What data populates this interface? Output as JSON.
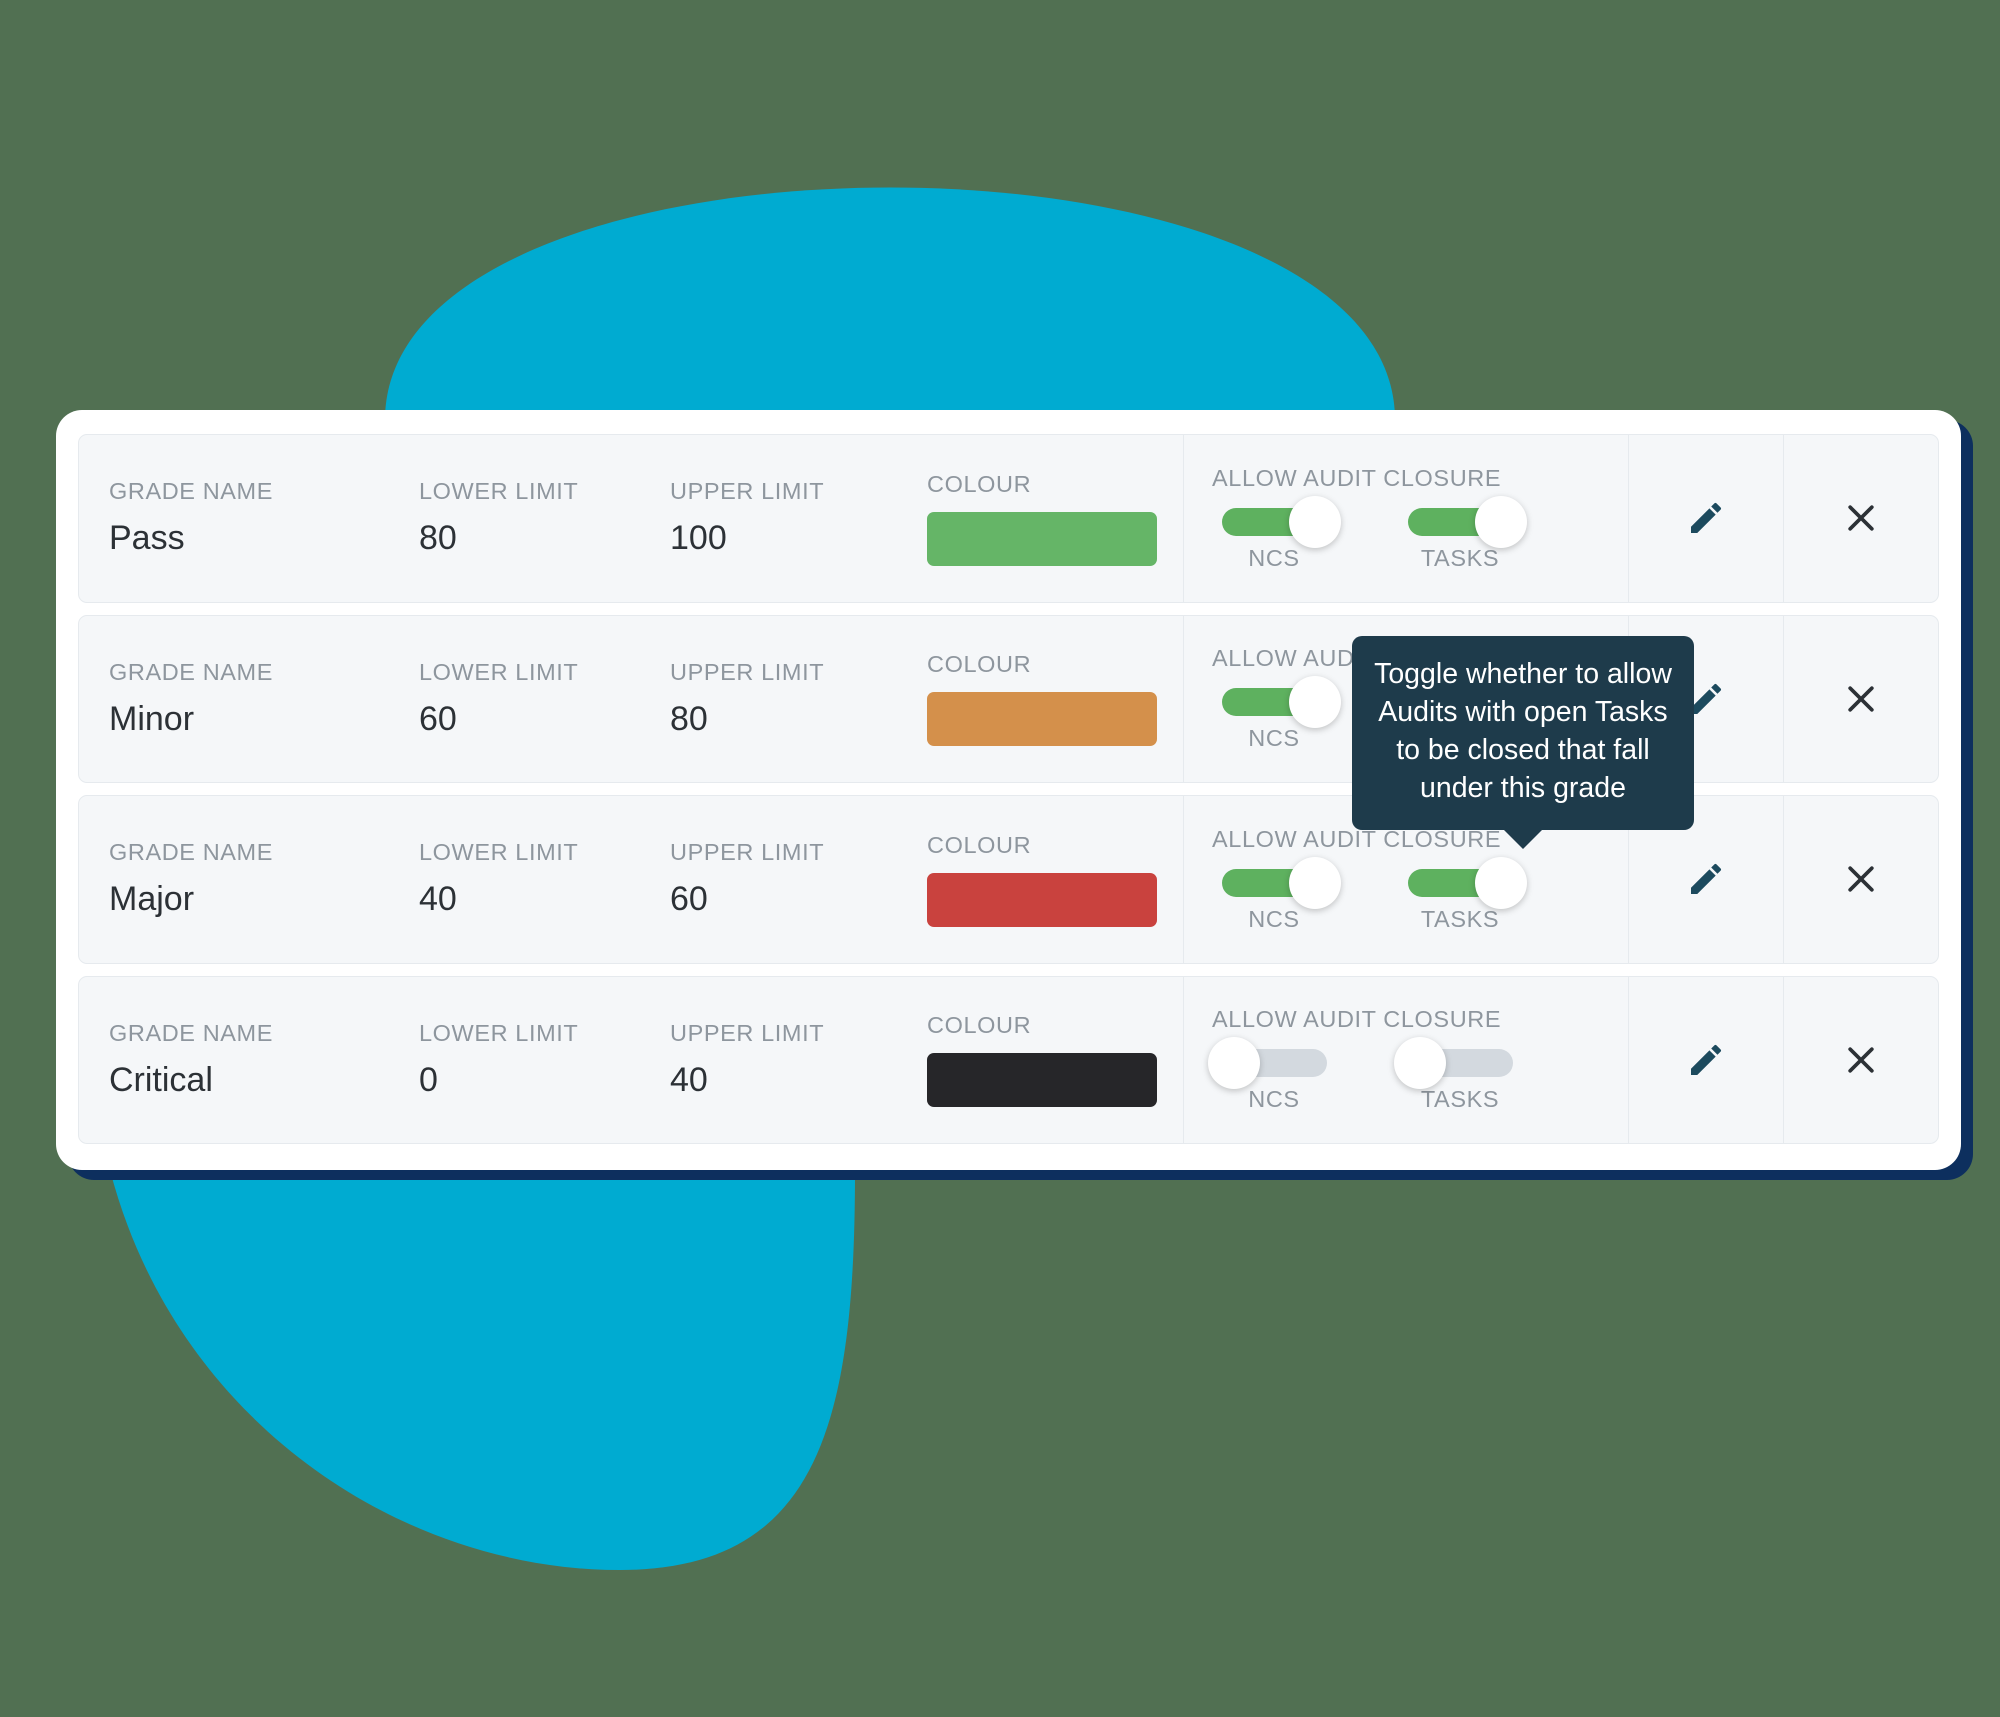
{
  "theme": {
    "page_background": "#517052",
    "blob_colour": "#00ABD1",
    "card_background": "#ffffff",
    "card_shadow_colour": "#0d2f5e",
    "row_background": "#f5f7f9",
    "label_colour": "#8e969e",
    "value_colour": "#2c3136",
    "toggle_on_colour": "#5eb15f",
    "toggle_off_colour": "#d3d9df",
    "tooltip_background": "#1e3b4b",
    "edit_icon_colour": "#1c4a5e",
    "delete_icon_colour": "#2c3136"
  },
  "labels": {
    "grade_name": "GRADE NAME",
    "lower_limit": "LOWER LIMIT",
    "upper_limit": "UPPER LIMIT",
    "colour": "COLOUR",
    "allow_audit_closure": "ALLOW AUDIT CLOSURE",
    "ncs": "NCS",
    "tasks": "TASKS"
  },
  "icons": {
    "edit": "pencil-icon",
    "delete": "close-icon"
  },
  "tooltip": {
    "text": "Toggle whether to allow Audits with open Tasks to be closed that fall under this grade"
  },
  "rows": [
    {
      "grade_name": "Pass",
      "lower_limit": "80",
      "upper_limit": "100",
      "colour": "#65B567",
      "ncs_on": true,
      "tasks_on": true
    },
    {
      "grade_name": "Minor",
      "lower_limit": "60",
      "upper_limit": "80",
      "colour": "#D4904B",
      "ncs_on": true,
      "tasks_on": true
    },
    {
      "grade_name": "Major",
      "lower_limit": "40",
      "upper_limit": "60",
      "colour": "#C9423E",
      "ncs_on": true,
      "tasks_on": true
    },
    {
      "grade_name": "Critical",
      "lower_limit": "0",
      "upper_limit": "40",
      "colour": "#262629",
      "ncs_on": false,
      "tasks_on": false
    }
  ]
}
